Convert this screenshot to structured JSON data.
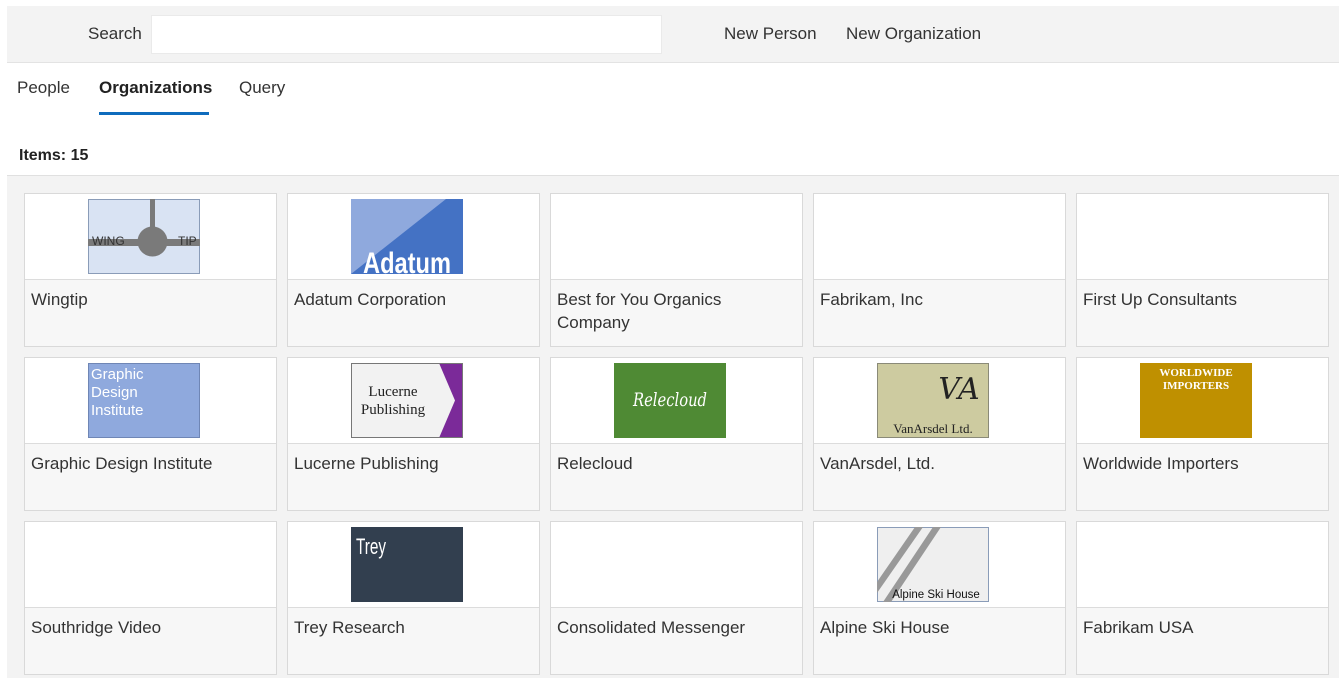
{
  "toolbar": {
    "search_label": "Search",
    "search_value": "",
    "new_person_label": "New Person",
    "new_organization_label": "New Organization"
  },
  "tabs": [
    {
      "label": "People",
      "active": false
    },
    {
      "label": "Organizations",
      "active": true
    },
    {
      "label": "Query",
      "active": false
    }
  ],
  "items_count": "Items: 15",
  "accent_color": "#0f6cbd",
  "organizations": [
    {
      "name": "Wingtip",
      "logo": "wingtip-logo",
      "logo_text": [
        "WING",
        "TIP"
      ]
    },
    {
      "name": "Adatum Corporation",
      "logo": "adatum-logo",
      "logo_text": [
        "Adatum"
      ]
    },
    {
      "name": "Best for You Organics Company",
      "logo": null
    },
    {
      "name": "Fabrikam, Inc",
      "logo": null
    },
    {
      "name": "First Up Consultants",
      "logo": null
    },
    {
      "name": "Graphic Design Institute",
      "logo": "graphic-design-institute-logo",
      "logo_text": [
        "Graphic",
        "Design",
        "Institute"
      ]
    },
    {
      "name": "Lucerne Publishing",
      "logo": "lucerne-publishing-logo",
      "logo_text": [
        "Lucerne",
        "Publishing"
      ]
    },
    {
      "name": "Relecloud",
      "logo": "relecloud-logo",
      "logo_text": [
        "Relecloud"
      ]
    },
    {
      "name": "VanArsdel, Ltd.",
      "logo": "vanarsdel-logo",
      "logo_text": [
        "VA",
        "VanArsdel Ltd."
      ]
    },
    {
      "name": "Worldwide Importers",
      "logo": "worldwide-importers-logo",
      "logo_text": [
        "WORLDWIDE",
        "IMPORTERS"
      ]
    },
    {
      "name": "Southridge Video",
      "logo": null
    },
    {
      "name": "Trey Research",
      "logo": "trey-research-logo",
      "logo_text": [
        "Trey"
      ]
    },
    {
      "name": "Consolidated Messenger",
      "logo": null
    },
    {
      "name": "Alpine Ski House",
      "logo": "alpine-ski-house-logo",
      "logo_text": [
        "Alpine Ski House"
      ]
    },
    {
      "name": "Fabrikam USA",
      "logo": null
    }
  ]
}
